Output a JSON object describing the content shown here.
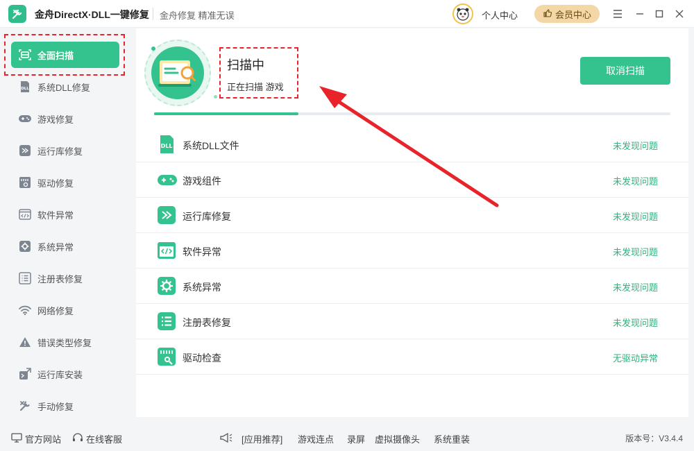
{
  "app": {
    "title": "金舟DirectX·DLL一键修复",
    "slogan": "金舟修复 精准无误",
    "personal_center": "个人中心",
    "vip_center": "会员中心"
  },
  "sidebar": {
    "items": [
      {
        "label": "全面扫描",
        "icon": "scan-icon",
        "active": true
      },
      {
        "label": "系统DLL修复",
        "icon": "dll-icon"
      },
      {
        "label": "游戏修复",
        "icon": "gamepad-icon"
      },
      {
        "label": "运行库修复",
        "icon": "runtime-icon"
      },
      {
        "label": "驱动修复",
        "icon": "driver-icon"
      },
      {
        "label": "软件异常",
        "icon": "code-window-icon"
      },
      {
        "label": "系统异常",
        "icon": "gear-icon"
      },
      {
        "label": "注册表修复",
        "icon": "list-icon"
      },
      {
        "label": "网络修复",
        "icon": "wifi-icon"
      },
      {
        "label": "错误类型修复",
        "icon": "warning-icon"
      },
      {
        "label": "运行库安装",
        "icon": "install-icon"
      },
      {
        "label": "手动修复",
        "icon": "wrench-icon"
      }
    ]
  },
  "scan": {
    "title": "扫描中",
    "status": "正在扫描 游戏",
    "cancel_label": "取消扫描",
    "progress": 0.28
  },
  "checks": [
    {
      "label": "系统DLL文件",
      "status": "未发现问题",
      "icon": "dll-icon"
    },
    {
      "label": "游戏组件",
      "status": "未发现问题",
      "icon": "gamepad-icon"
    },
    {
      "label": "运行库修复",
      "status": "未发现问题",
      "icon": "runtime-icon"
    },
    {
      "label": "软件异常",
      "status": "未发现问题",
      "icon": "code-window-icon"
    },
    {
      "label": "系统异常",
      "status": "未发现问题",
      "icon": "gear-icon"
    },
    {
      "label": "注册表修复",
      "status": "未发现问题",
      "icon": "list-icon"
    },
    {
      "label": "驱动检查",
      "status": "无驱动异常",
      "icon": "driver-icon"
    }
  ],
  "footer": {
    "official_site": "官方网站",
    "online_service": "在线客服",
    "recommend": "[应用推荐]",
    "links": [
      "游戏连点",
      "录屏",
      "虚拟摄像头",
      "系统重装"
    ],
    "version": "版本号：V3.4.4"
  },
  "colors": {
    "accent": "#34c38f",
    "status_ok": "#35b07e",
    "annotation_red": "#e8232a",
    "vip": "#f3d7a6"
  }
}
